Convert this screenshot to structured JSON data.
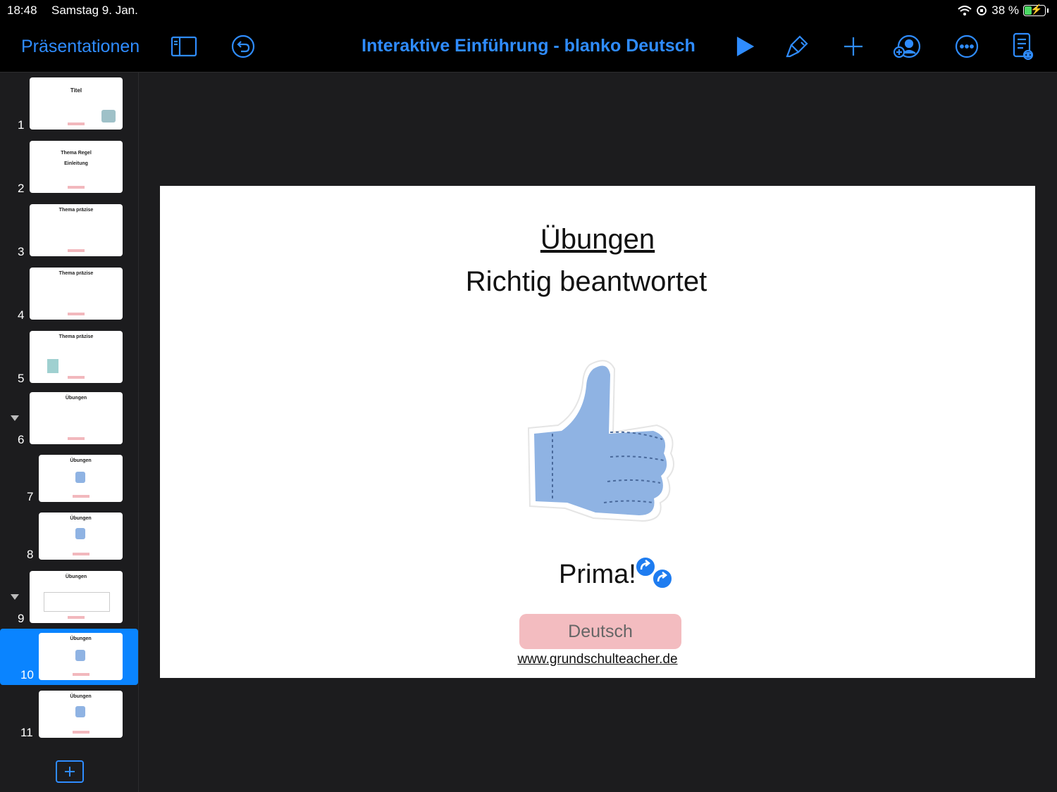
{
  "status": {
    "time": "18:48",
    "date": "Samstag 9. Jan.",
    "battery": "38 %",
    "battery_level": 0.38
  },
  "toolbar": {
    "back_label": "Präsentationen",
    "title": "Interaktive Einführung - blanko  Deutsch",
    "icons": [
      "sidebar-icon",
      "undo-icon",
      "play-icon",
      "format-brush-icon",
      "plus-icon",
      "collaborate-icon",
      "more-icon",
      "presenter-notes-icon"
    ]
  },
  "slides": [
    {
      "num": "1",
      "text": "Titel",
      "selected": false
    },
    {
      "num": "2",
      "text": "Thema Regel Einleitung",
      "selected": false
    },
    {
      "num": "3",
      "text": "Thema präzise",
      "selected": false
    },
    {
      "num": "4",
      "text": "Thema präzise",
      "selected": false
    },
    {
      "num": "5",
      "text": "Thema präzise",
      "selected": false
    },
    {
      "num": "6",
      "text": "Übungen",
      "selected": false
    },
    {
      "num": "7",
      "text": "Übungen",
      "selected": false
    },
    {
      "num": "8",
      "text": "Übungen",
      "selected": false
    },
    {
      "num": "9",
      "text": "Übungen",
      "selected": false
    },
    {
      "num": "10",
      "text": "Übungen",
      "selected": true
    },
    {
      "num": "11",
      "text": "Übungen",
      "selected": false
    }
  ],
  "slide": {
    "title": "Übungen",
    "subtitle": "Richtig beantwortet",
    "caption": "Prima!",
    "badge": "Deutsch",
    "url": "www.grundschulteacher.de"
  },
  "colors": {
    "accent": "#2f8cff",
    "thumb_fill": "#8fb3e3",
    "badge": "#f3bcc0",
    "selection": "#0a84ff"
  }
}
